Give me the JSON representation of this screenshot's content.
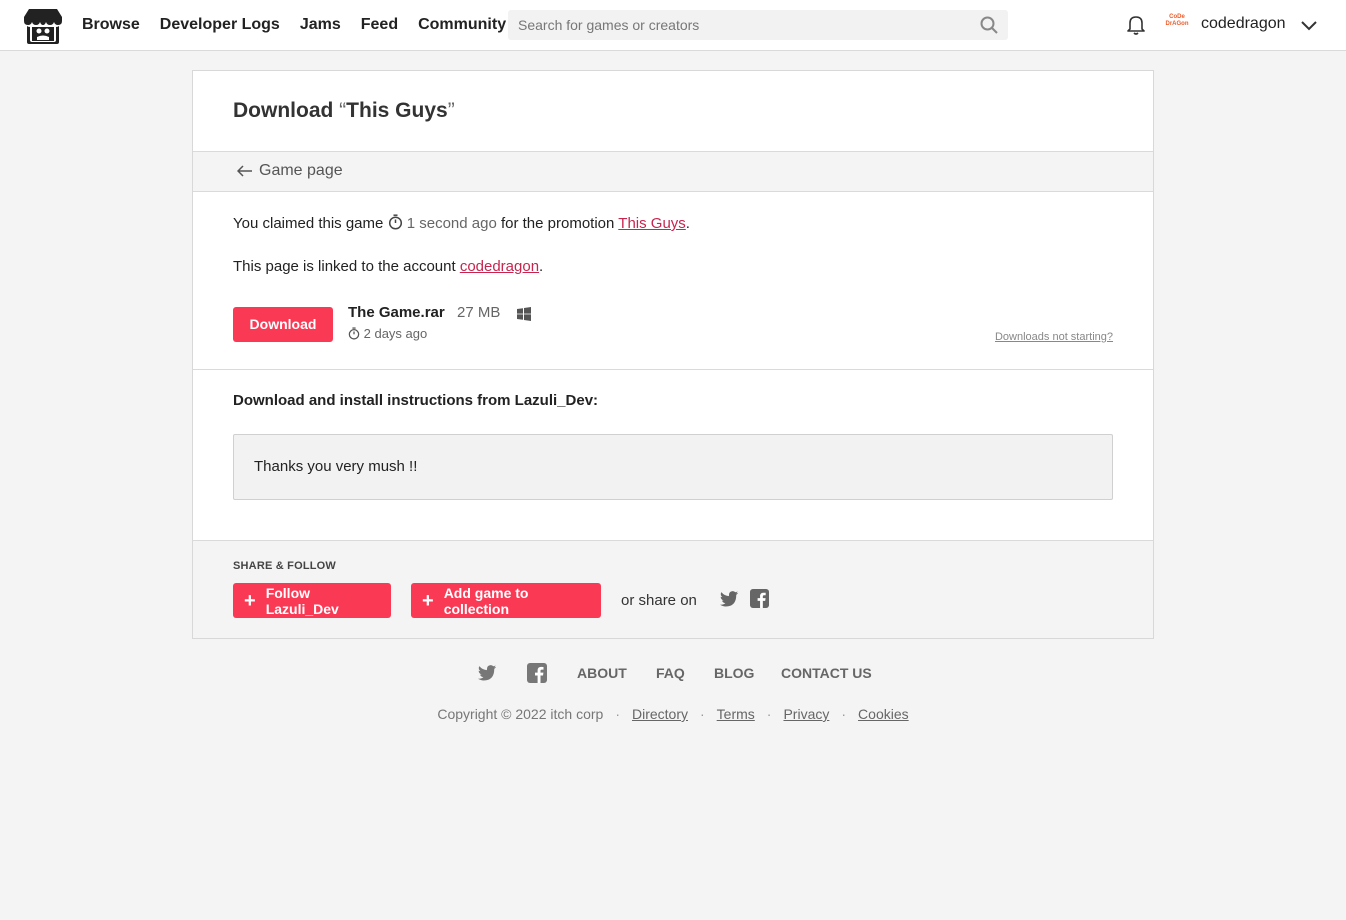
{
  "header": {
    "logo_icon": "itch-logo-icon",
    "nav": [
      "Browse",
      "Developer Logs",
      "Jams",
      "Feed",
      "Community"
    ],
    "search_placeholder": "Search for games or creators",
    "username": "codedragon",
    "avatar_text": "CoDe DrAGon"
  },
  "card": {
    "title_prefix": "Download ",
    "open_quote": "“",
    "game_name": "This Guys",
    "close_quote": "”",
    "back_label": "Game page",
    "claim": {
      "prefix": "You claimed this game",
      "time": "1 second ago",
      "middle": "for the promotion",
      "promotion": "This Guys",
      "suffix": "."
    },
    "linked": {
      "prefix": "This page is linked to the account",
      "account": "codedragon",
      "suffix": "."
    },
    "download": {
      "button": "Download",
      "file_name": "The Game.rar",
      "file_size": "27 MB",
      "platform_icon": "windows-icon",
      "uploaded": "2 days ago",
      "help_link": "Downloads not starting?"
    },
    "instructions": {
      "title": "Download and install instructions from Lazuli_Dev:",
      "text": "Thanks you very mush !!"
    },
    "share": {
      "label": "SHARE & FOLLOW",
      "follow_button": "Follow Lazuli_Dev",
      "collection_button": "Add game to collection",
      "share_on": "or share on"
    }
  },
  "footer": {
    "links": [
      "ABOUT",
      "FAQ",
      "BLOG",
      "CONTACT US"
    ],
    "copyright": "Copyright © 2022 itch corp",
    "legal": [
      "Directory",
      "Terms",
      "Privacy",
      "Cookies"
    ]
  },
  "colors": {
    "accent": "#fa3a55",
    "link": "#c7254e",
    "background": "#f4f4f4"
  }
}
